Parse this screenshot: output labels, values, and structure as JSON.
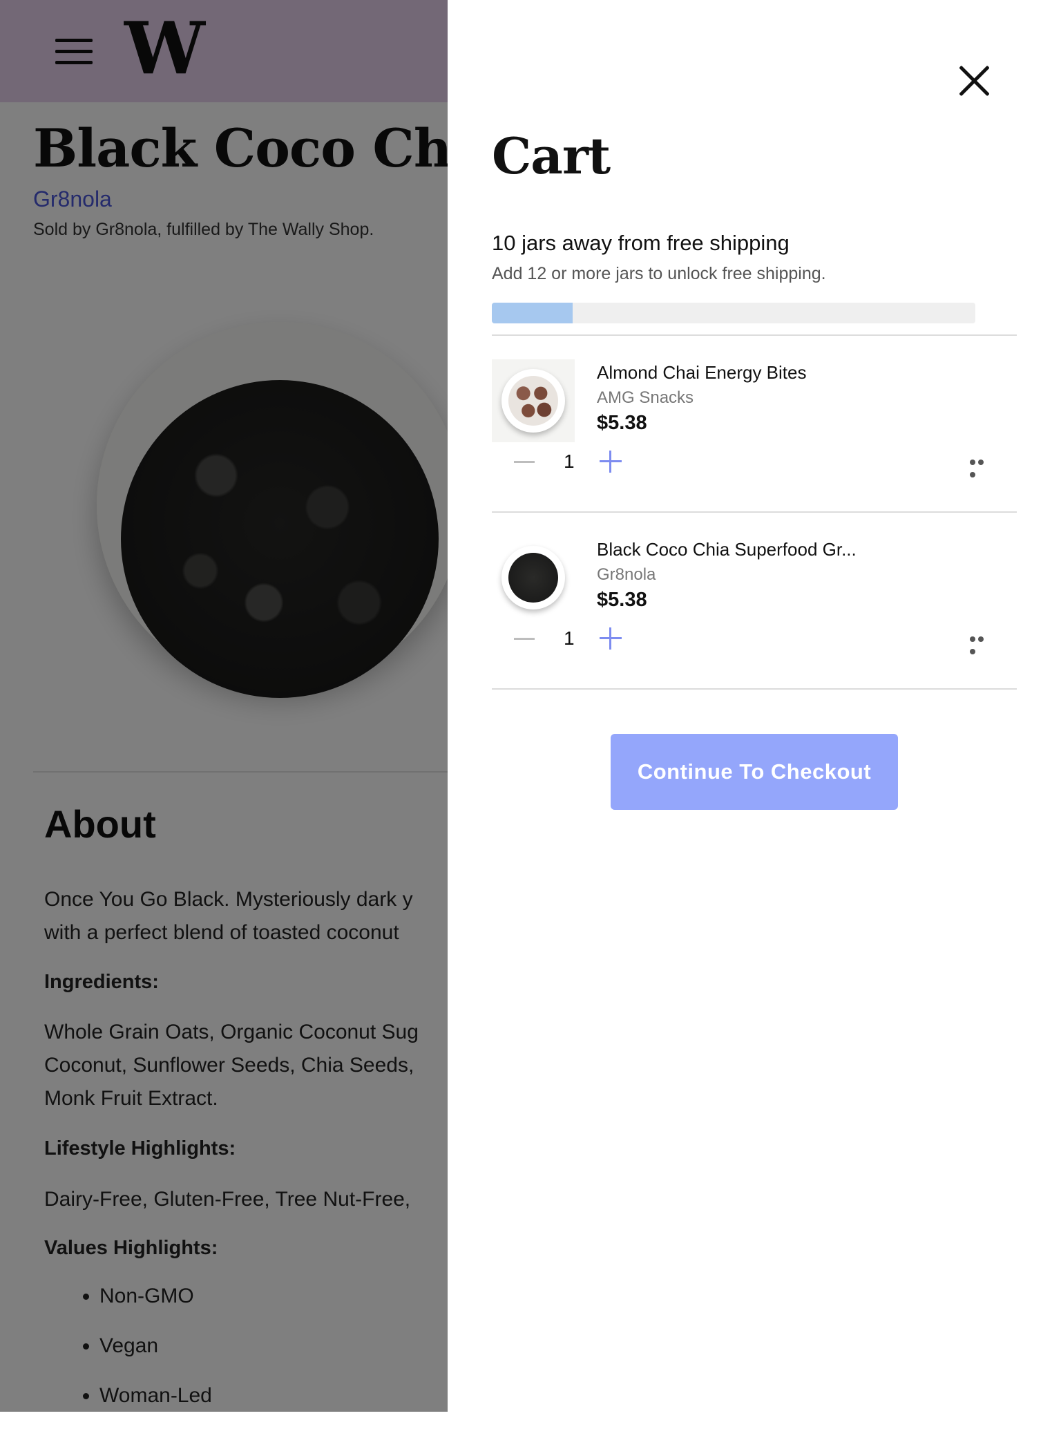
{
  "header": {
    "logo_text": "W",
    "menu_icon": "hamburger-icon",
    "background_color": "#e6d0ec"
  },
  "product": {
    "title": "Black Coco Chia S",
    "brand": "Gr8nola",
    "sold_by": "Sold by Gr8nola, fulfilled by The Wally Shop.",
    "about_heading": "About",
    "about_text": "Once You Go Black. Mysteriously dark y\nwith a perfect blend of toasted coconut",
    "ingredients_heading": "Ingredients:",
    "ingredients_text": "Whole Grain Oats, Organic Coconut Sug\nCoconut, Sunflower Seeds, Chia Seeds,\nMonk Fruit Extract.",
    "lifestyle_heading": "Lifestyle Highlights:",
    "lifestyle_text": "Dairy-Free, Gluten-Free, Tree Nut-Free,",
    "values_heading": "Values Highlights:",
    "values": [
      "Non-GMO",
      "Vegan",
      "Woman-Led"
    ]
  },
  "cart": {
    "title": "Cart",
    "close_icon": "close-icon",
    "shipping_message": "10 jars away from free shipping",
    "shipping_subtext": "Add 12 or more jars to unlock free shipping.",
    "shipping_progress_percent": 16.7,
    "progress_color": "#a6c8ef",
    "items": [
      {
        "name": "Almond Chai Energy Bites",
        "vendor": "AMG Snacks",
        "price": "$5.38",
        "quantity": "1"
      },
      {
        "name": "Black Coco Chia Superfood Gr...",
        "vendor": "Gr8nola",
        "price": "$5.38",
        "quantity": "1"
      }
    ],
    "checkout_label": "Continue To Checkout",
    "checkout_color": "#94a6fb"
  }
}
